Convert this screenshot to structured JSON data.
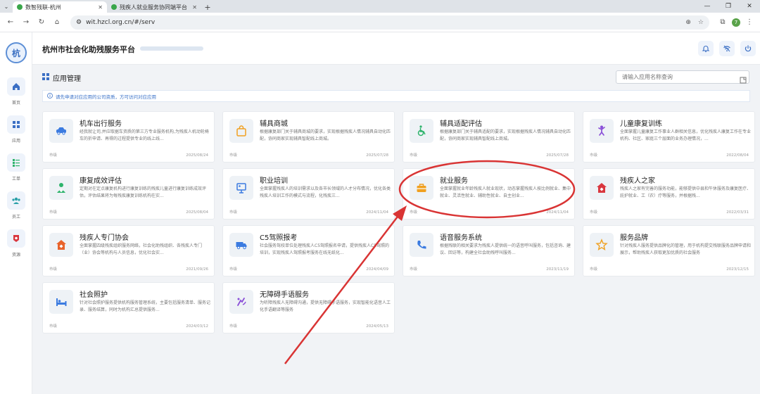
{
  "browser": {
    "tabs": [
      {
        "title": "数智残联-杭州"
      },
      {
        "title": "残疾人就业服务协同端平台"
      }
    ],
    "url": "wit.hzcl.org.cn/#/serv",
    "profile_initial": "7"
  },
  "app": {
    "logo_text": "杭",
    "title": "杭州市社会化助残服务平台"
  },
  "sidebar": {
    "items": [
      {
        "label": "首页",
        "icon": "home-icon"
      },
      {
        "label": "应用",
        "icon": "grid-icon"
      },
      {
        "label": "工单",
        "icon": "list-icon"
      },
      {
        "label": "员工",
        "icon": "users-icon"
      },
      {
        "label": "资源",
        "icon": "badge-icon"
      }
    ]
  },
  "page": {
    "title": "应用管理",
    "search_placeholder": "请输入应用名称查询",
    "notice": "请先申请对应应用的公司资质，方可访问对应应用"
  },
  "cards": [
    {
      "name": "机车出行服务",
      "desc": "经我就让司,并应取据车资质的第三方专业服务机构,为残疾人机动轮椅车的折申请、再得的过程提供专业的线上线...",
      "level": "市级",
      "date": "2025/08/24",
      "icon": "car-icon",
      "color": "#3b7be0"
    },
    {
      "name": "辅具商城",
      "desc": "根据康复部门关于辅具商城的要求，实现根据残疾人情况辅具自动化匹配，协同商家实现辅具智配线上商城。",
      "level": "市级",
      "date": "2025/07/28",
      "icon": "shopping-bag-icon",
      "color": "#f0a020"
    },
    {
      "name": "辅具适配评估",
      "desc": "根据康复部门关于辅具适配的要求，实现根据残疾人情况辅具自动化匹配，协同商家实现辅具智配线上商城。",
      "level": "市级",
      "date": "2025/07/28",
      "icon": "wheelchair-icon",
      "color": "#2db36b"
    },
    {
      "name": "儿童康复训练",
      "desc": "全面掌握儿童康复工作事业人群相关信息，优化残疾人康复工作在专业机构、社区、家庭三个层面的业务办理情况，...",
      "level": "市级",
      "date": "2022/08/04",
      "icon": "child-icon",
      "color": "#8a4fd8"
    },
    {
      "name": "康复成效评估",
      "desc": "定期对在定点康复机构进行康复训练的残疾儿童进行康复训练成效评估，评估结果将为每残疾康复训练机构在实...",
      "level": "市级",
      "date": "2025/08/04",
      "icon": "doctor-icon",
      "color": "#2db36b"
    },
    {
      "name": "职业培训",
      "desc": "全面掌握残疾人的培训需求以及各市长领域的人才分布情况，优化各类残疾人培训工作的模式与流程，化残疾三...",
      "level": "市级",
      "date": "2024/11/04",
      "icon": "presentation-icon",
      "color": "#3b7be0"
    },
    {
      "name": "就业服务",
      "desc": "全面掌握就业年龄残疾人就业现状，动态掌握残疾人按比例就业、集中就业、灵活性就业、辅助性就业、自主创业...",
      "level": "市级",
      "date": "2024/11/04",
      "icon": "briefcase-icon",
      "color": "#f0a020"
    },
    {
      "name": "残疾人之家",
      "desc": "残疾人之家有完善的服务功能，能够提供中县和午休服务及康复医疗、庇护就业、工（农）疗等服务，并根据残...",
      "level": "市级",
      "date": "2022/03/31",
      "icon": "house-icon",
      "color": "#d9363e"
    },
    {
      "name": "残疾人专门协会",
      "desc": "全面掌握四级残疾组织服务网络，社会化助残组织、各残疾人专门（业）协会等机构与人员信息，优化社会实...",
      "level": "市级",
      "date": "2021/09/26",
      "icon": "house-icon",
      "color": "#e8632b"
    },
    {
      "name": "C5驾照报考",
      "desc": "社会服务驾校单位处理残疾人C5驾照报名申请，提供残疾人C5驾照的培训，实现残疾人驾照报考服务在线无纸化...",
      "level": "市级",
      "date": "2024/04/09",
      "icon": "truck-icon",
      "color": "#3b7be0"
    },
    {
      "name": "语音服务系统",
      "desc": "根据残联的相关要求为残疾人提供统一的语音呼叫服务，包括咨询、建议、回访等，构建全社会助残呼叫服务...",
      "level": "市级",
      "date": "2023/11/19",
      "icon": "phone-icon",
      "color": "#3b7be0"
    },
    {
      "name": "服务品牌",
      "desc": "针对残疾人服务提供品牌化的管理，用于机构提交残联服务品牌申请和展示，帮助残疾人获取更加优质的社会服务",
      "level": "市级",
      "date": "2023/12/15",
      "icon": "star-icon",
      "color": "#f0a020"
    },
    {
      "name": "社会照护",
      "desc": "针对社会照护服务提供机构服务管理系统，主要包括服务清单、服务记录、服务结算，同时为机构汇总提供服务...",
      "level": "市级",
      "date": "2024/03/12",
      "icon": "bed-icon",
      "color": "#3b7be0"
    },
    {
      "name": "无障碍手语服务",
      "desc": "为听障残疾人无障碍沟通，提供无障碍手语服务，实现智能化语音人工化手语翻译等服务",
      "level": "市级",
      "date": "2024/05/13",
      "icon": "sign-language-icon",
      "color": "#8a4fd8"
    }
  ]
}
